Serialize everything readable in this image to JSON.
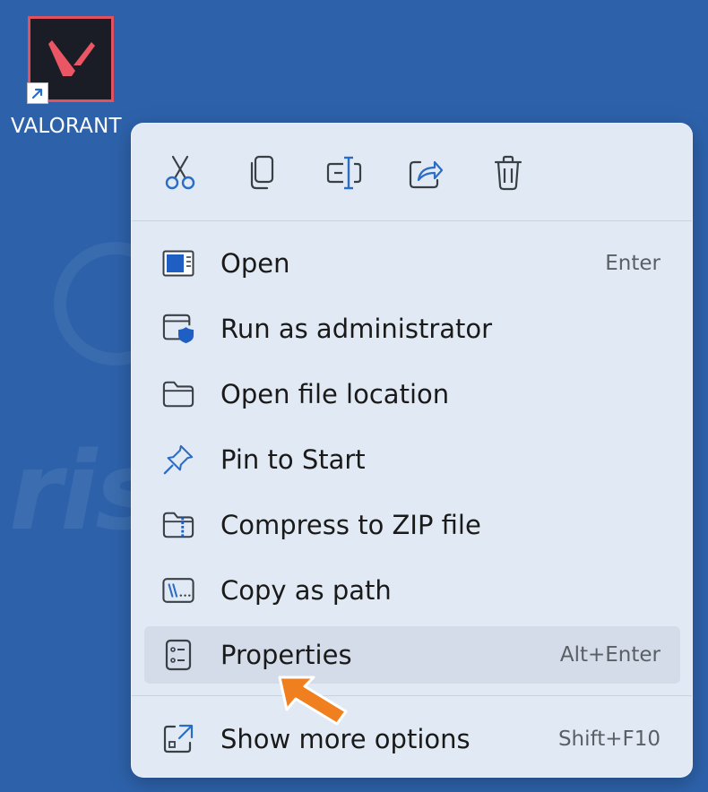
{
  "desktop": {
    "icon_label": "VALORANT",
    "background_color": "#2d62ab",
    "app_icon": "valorant-logo-icon",
    "shortcut_overlay": "shortcut-arrow-icon"
  },
  "watermark": {
    "line1": "PC",
    "line2": "risk.com"
  },
  "context_menu": {
    "quick_actions": [
      {
        "name": "cut",
        "icon": "scissors-icon"
      },
      {
        "name": "copy",
        "icon": "copy-icon"
      },
      {
        "name": "rename",
        "icon": "rename-icon"
      },
      {
        "name": "share",
        "icon": "share-icon"
      },
      {
        "name": "delete",
        "icon": "trash-icon"
      }
    ],
    "items": [
      {
        "label": "Open",
        "shortcut": "Enter",
        "icon": "window-icon"
      },
      {
        "label": "Run as administrator",
        "shortcut": "",
        "icon": "shield-window-icon"
      },
      {
        "label": "Open file location",
        "shortcut": "",
        "icon": "folder-icon"
      },
      {
        "label": "Pin to Start",
        "shortcut": "",
        "icon": "pin-icon"
      },
      {
        "label": "Compress to ZIP file",
        "shortcut": "",
        "icon": "zip-folder-icon"
      },
      {
        "label": "Copy as path",
        "shortcut": "",
        "icon": "path-icon"
      },
      {
        "label": "Properties",
        "shortcut": "Alt+Enter",
        "icon": "properties-icon",
        "hovered": true
      },
      {
        "label": "Show more options",
        "shortcut": "Shift+F10",
        "icon": "expand-icon"
      }
    ]
  },
  "colors": {
    "accent_blue": "#2b6cc4",
    "valorant_red": "#e0525f",
    "pointer_orange": "#f07f1f"
  }
}
